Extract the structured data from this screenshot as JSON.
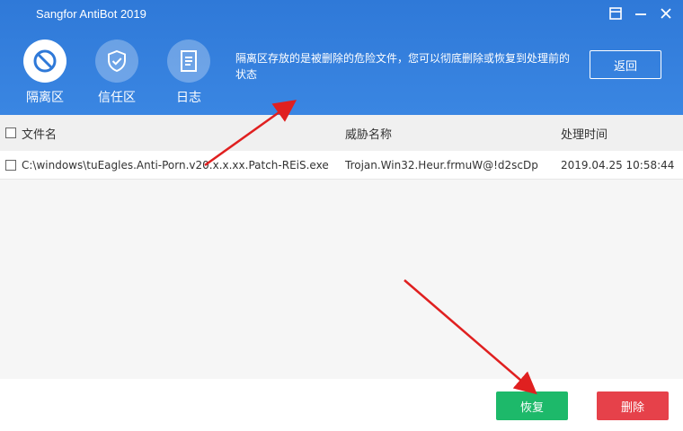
{
  "window": {
    "title": "Sangfor AntiBot 2019",
    "controls": [
      "menu",
      "minimize",
      "close"
    ]
  },
  "nav": {
    "items": [
      {
        "label": "隔离区",
        "icon": "quarantine-icon",
        "active": true
      },
      {
        "label": "信任区",
        "icon": "shield-check-icon",
        "active": false
      },
      {
        "label": "日志",
        "icon": "log-icon",
        "active": false
      }
    ]
  },
  "info_text": "隔离区存放的是被删除的危险文件，您可以彻底删除或恢复到处理前的状态",
  "back_label": "返回",
  "table": {
    "columns": [
      "文件名",
      "威胁名称",
      "处理时间"
    ],
    "rows": [
      {
        "file": "C:\\windows\\tuEagles.Anti-Porn.v20.x.x.xx.Patch-REiS.exe",
        "threat": "Trojan.Win32.Heur.frmuW@!d2scDp",
        "time": "2019.04.25 10:58:44"
      }
    ]
  },
  "buttons": {
    "restore": "恢复",
    "delete": "删除"
  },
  "colors": {
    "header": "#3a86e2",
    "restore": "#1db96a",
    "delete": "#e6414a",
    "arrow": "#e02020"
  }
}
